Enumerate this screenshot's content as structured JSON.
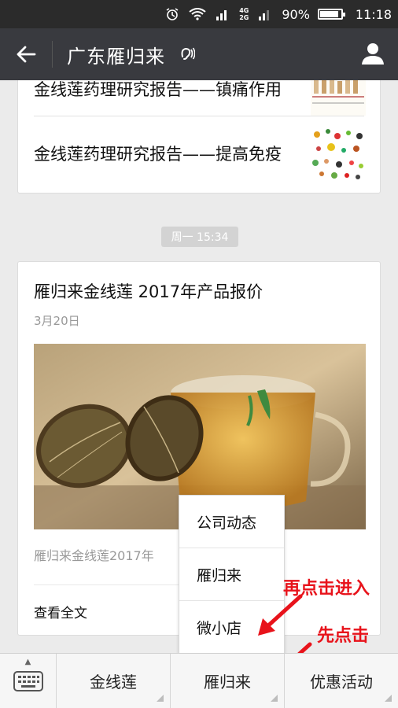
{
  "status_bar": {
    "network": "4G",
    "network2": "2G",
    "battery": "90%",
    "time": "11:18",
    "battery_level": 0.9
  },
  "header": {
    "title": "广东雁归来"
  },
  "earlier_card": {
    "items": [
      {
        "title": "金线莲药理研究报告——镇痛作用"
      },
      {
        "title": "金线莲药理研究报告——提高免疫"
      }
    ]
  },
  "timestamp": "周一 15:34",
  "article": {
    "title": "雁归来金线莲 2017年产品报价",
    "date": "3月20日",
    "digest": "雁归来金线莲2017年",
    "read_more": "查看全文"
  },
  "popup_menu": {
    "items": [
      "公司动态",
      "雁归来",
      "微小店"
    ]
  },
  "annotations": {
    "then_click": "再点击进入",
    "first_click": "先点击"
  },
  "bottom_menu": {
    "items": [
      "金线莲",
      "雁归来",
      "优惠活动"
    ]
  },
  "colors": {
    "header_bg": "#393a3f",
    "statusbar_bg": "#2b2b2b",
    "annotation_red": "#e8131b"
  }
}
